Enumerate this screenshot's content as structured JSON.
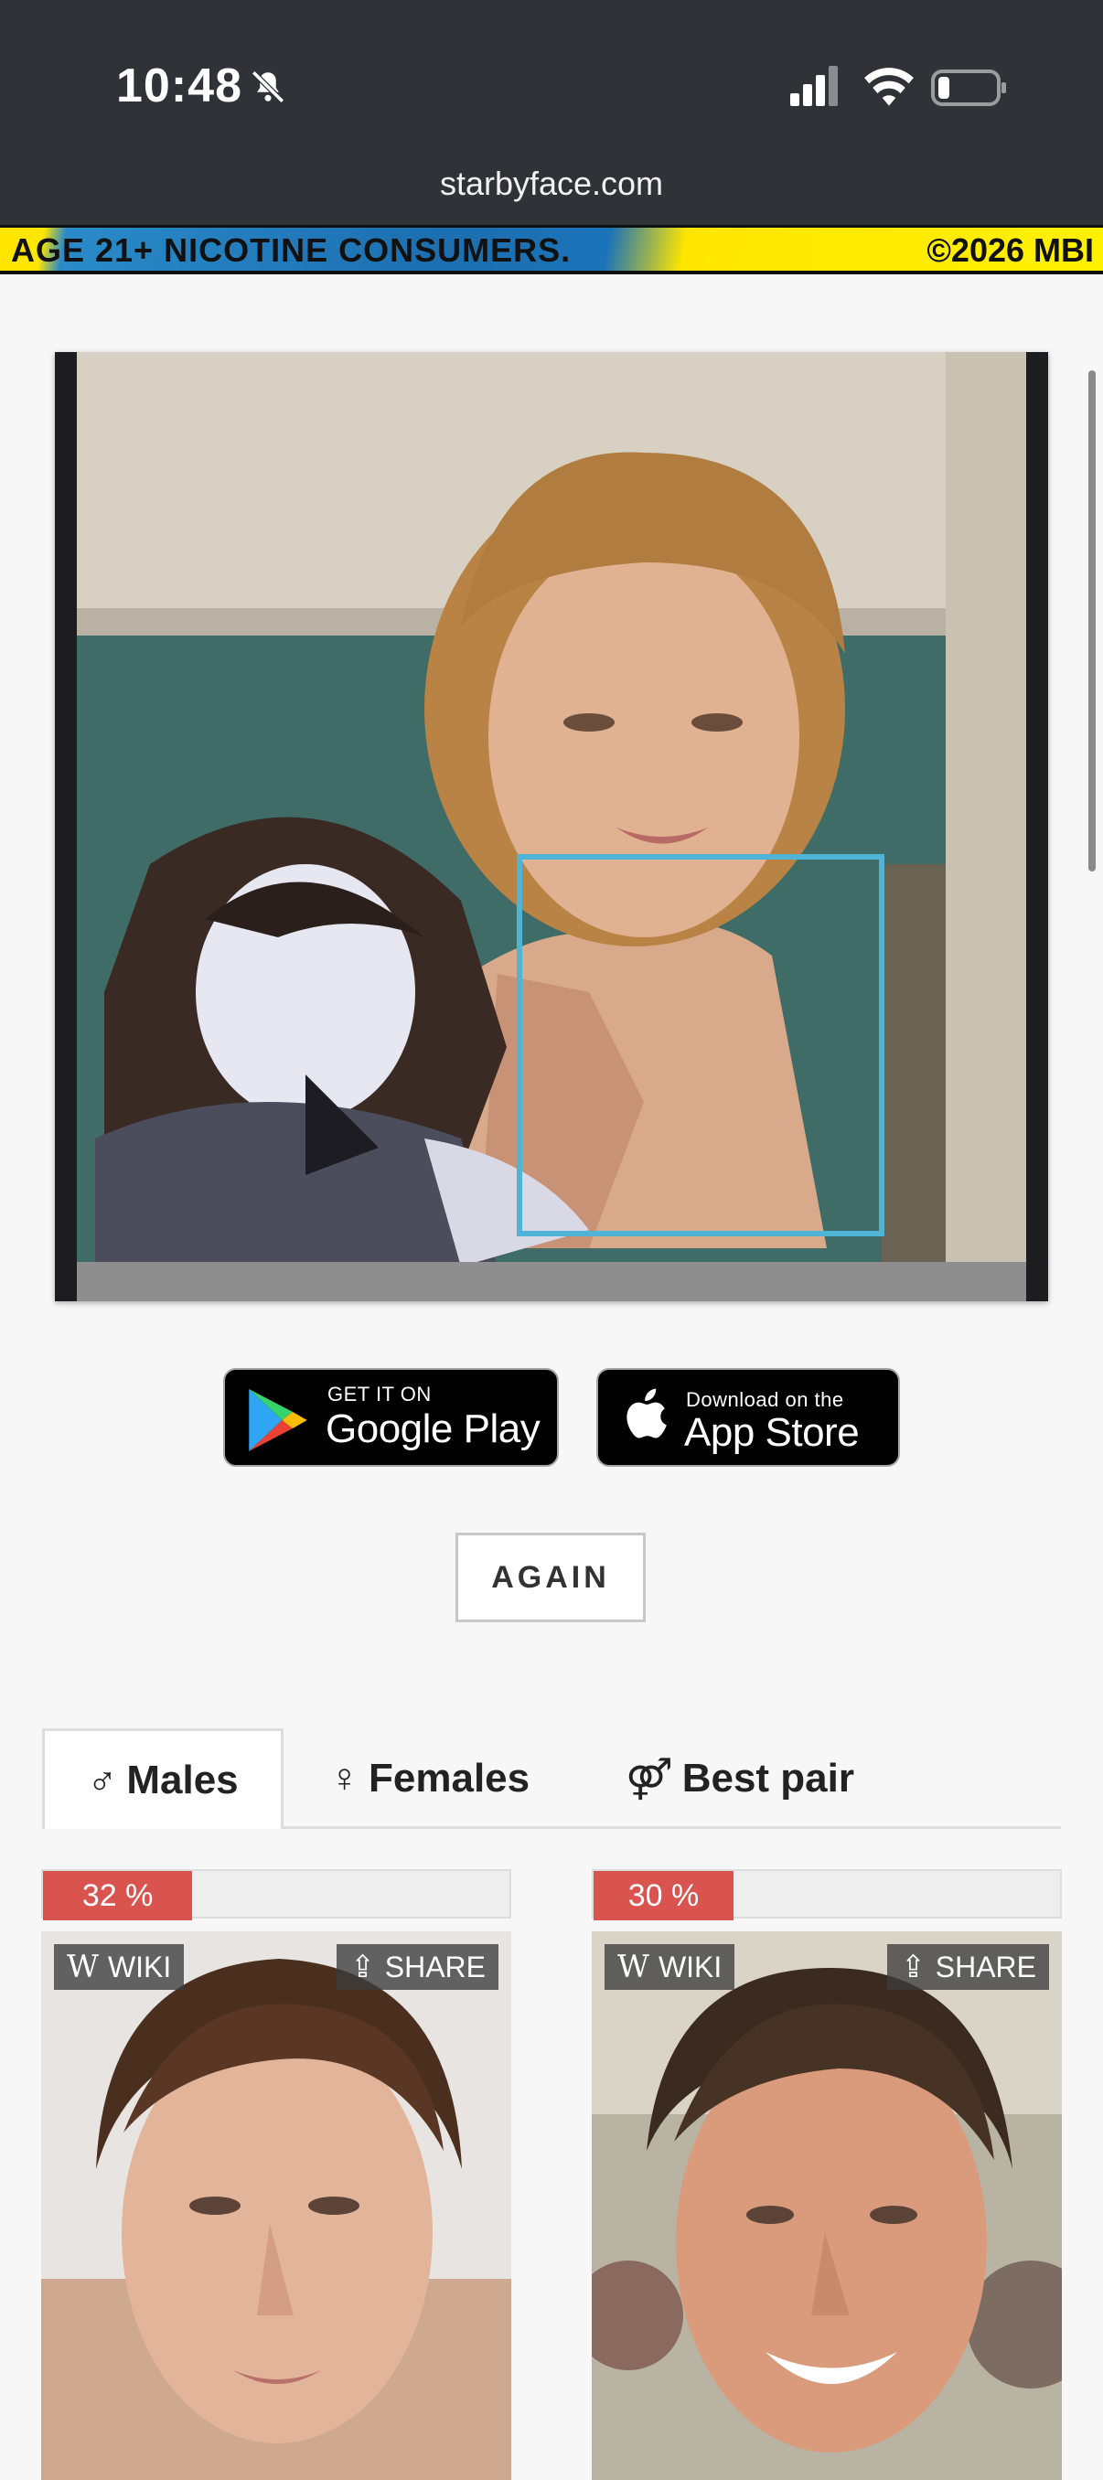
{
  "status_bar": {
    "time": "10:48",
    "silent_icon": "bell-slash-icon",
    "signal_icon": "signal-icon",
    "wifi_icon": "wifi-icon",
    "battery_icon": "battery-icon"
  },
  "browser": {
    "url": "starbyface.com"
  },
  "ad": {
    "left_text": "AGE 21+ NICOTINE CONSUMERS.",
    "right_text": "©2026 MBI"
  },
  "result": {
    "face_box_color": "#4fb4d6"
  },
  "stores": {
    "google": {
      "small": "GET IT ON",
      "big": "Google Play"
    },
    "apple": {
      "small": "Download on the",
      "big": "App Store"
    }
  },
  "again_label": "AGAIN",
  "tabs": [
    {
      "symbol": "♂",
      "label": "Males",
      "active": true
    },
    {
      "symbol": "♀",
      "label": "Females",
      "active": false
    },
    {
      "symbol": "⚤",
      "label": "Best pair",
      "active": false
    }
  ],
  "matches": [
    {
      "percent_label": "32 %",
      "percent": 32,
      "wiki_label": "WIKI",
      "share_label": "SHARE"
    },
    {
      "percent_label": "30 %",
      "percent": 30,
      "wiki_label": "WIKI",
      "share_label": "SHARE"
    }
  ],
  "colors": {
    "accent_red": "#d9534f",
    "topbar": "#2f3236"
  }
}
